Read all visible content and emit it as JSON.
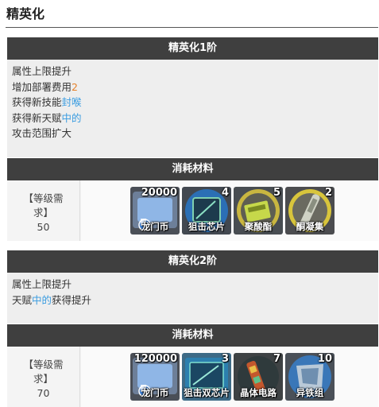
{
  "page_title": "精英化",
  "stage1": {
    "header": "精英化1阶",
    "lines": [
      {
        "pre": "属性上限提升",
        "hl": "",
        "post": ""
      },
      {
        "pre": "增加部署费用",
        "hl": "2",
        "post": ""
      },
      {
        "pre": "获得新技能",
        "hl": "封喉",
        "post": ""
      },
      {
        "pre": "获得新天赋",
        "hl": "中的",
        "post": ""
      },
      {
        "pre": "攻击范围扩大",
        "hl": "",
        "post": ""
      }
    ],
    "materials_header": "消耗材料",
    "requirement": {
      "label_line1": "【等级需",
      "label_line2": "求】",
      "value": "50"
    },
    "items": [
      {
        "name": "龙门币",
        "count": "20000"
      },
      {
        "name": "狙击芯片",
        "count": "4"
      },
      {
        "name": "聚酸酯",
        "count": "5"
      },
      {
        "name": "酮凝集",
        "count": "2"
      }
    ]
  },
  "stage2": {
    "header": "精英化2阶",
    "lines": [
      {
        "pre": "属性上限提升",
        "hl": "",
        "post": ""
      },
      {
        "pre": "天赋",
        "hl": "中的",
        "post": "获得提升"
      }
    ],
    "materials_header": "消耗材料",
    "requirement": {
      "label_line1": "【等级需",
      "label_line2": "求】",
      "value": "70"
    },
    "items": [
      {
        "name": "龙门币",
        "count": "120000"
      },
      {
        "name": "狙击双芯片",
        "count": "3"
      },
      {
        "name": "晶体电路",
        "count": "7"
      },
      {
        "name": "异铁组",
        "count": "10"
      }
    ]
  },
  "colors": {
    "header_bg": "#3f3f3f",
    "highlight_orange": "#e6812b",
    "highlight_blue": "#3a9ce0"
  }
}
